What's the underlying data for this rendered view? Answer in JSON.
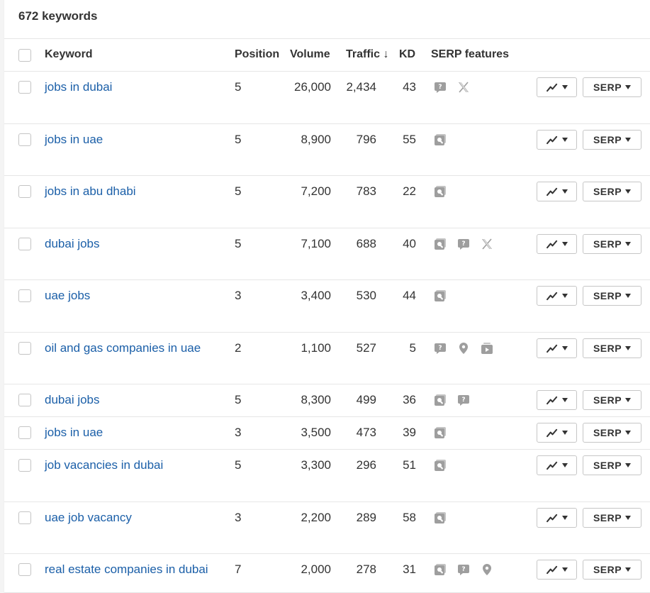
{
  "header": {
    "title": "672 keywords"
  },
  "columns": {
    "keyword": "Keyword",
    "position": "Position",
    "volume": "Volume",
    "traffic": "Traffic ↓",
    "kd": "KD",
    "serp_features": "SERP features"
  },
  "buttons": {
    "serp_label": "SERP"
  },
  "rows": [
    {
      "keyword": "jobs in dubai",
      "position": "5",
      "volume": "26,000",
      "traffic": "2,434",
      "kd": "43",
      "features": [
        "qa-icon",
        "x-icon"
      ]
    },
    {
      "keyword": "jobs in uae",
      "position": "5",
      "volume": "8,900",
      "traffic": "796",
      "kd": "55",
      "features": [
        "image-icon"
      ]
    },
    {
      "keyword": "jobs in abu dhabi",
      "position": "5",
      "volume": "7,200",
      "traffic": "783",
      "kd": "22",
      "features": [
        "image-icon"
      ]
    },
    {
      "keyword": "dubai jobs",
      "position": "5",
      "volume": "7,100",
      "traffic": "688",
      "kd": "40",
      "features": [
        "image-icon",
        "qa-icon",
        "x-icon"
      ]
    },
    {
      "keyword": "uae jobs",
      "position": "3",
      "volume": "3,400",
      "traffic": "530",
      "kd": "44",
      "features": [
        "image-icon"
      ]
    },
    {
      "keyword": "oil and gas companies in uae",
      "position": "2",
      "volume": "1,100",
      "traffic": "527",
      "kd": "5",
      "features": [
        "qa-icon",
        "map-pin-icon",
        "video-icon"
      ]
    },
    {
      "keyword": "dubai jobs",
      "position": "5",
      "volume": "8,300",
      "traffic": "499",
      "kd": "36",
      "features": [
        "image-icon",
        "qa-icon"
      ]
    },
    {
      "keyword": "jobs in uae",
      "position": "3",
      "volume": "3,500",
      "traffic": "473",
      "kd": "39",
      "features": [
        "image-icon"
      ]
    },
    {
      "keyword": "job vacancies in dubai",
      "position": "5",
      "volume": "3,300",
      "traffic": "296",
      "kd": "51",
      "features": [
        "image-icon"
      ]
    },
    {
      "keyword": "uae job vacancy",
      "position": "3",
      "volume": "2,200",
      "traffic": "289",
      "kd": "58",
      "features": [
        "image-icon"
      ]
    },
    {
      "keyword": "real estate companies in dubai",
      "position": "7",
      "volume": "2,000",
      "traffic": "278",
      "kd": "31",
      "features": [
        "image-icon",
        "qa-icon",
        "map-pin-icon"
      ]
    }
  ]
}
